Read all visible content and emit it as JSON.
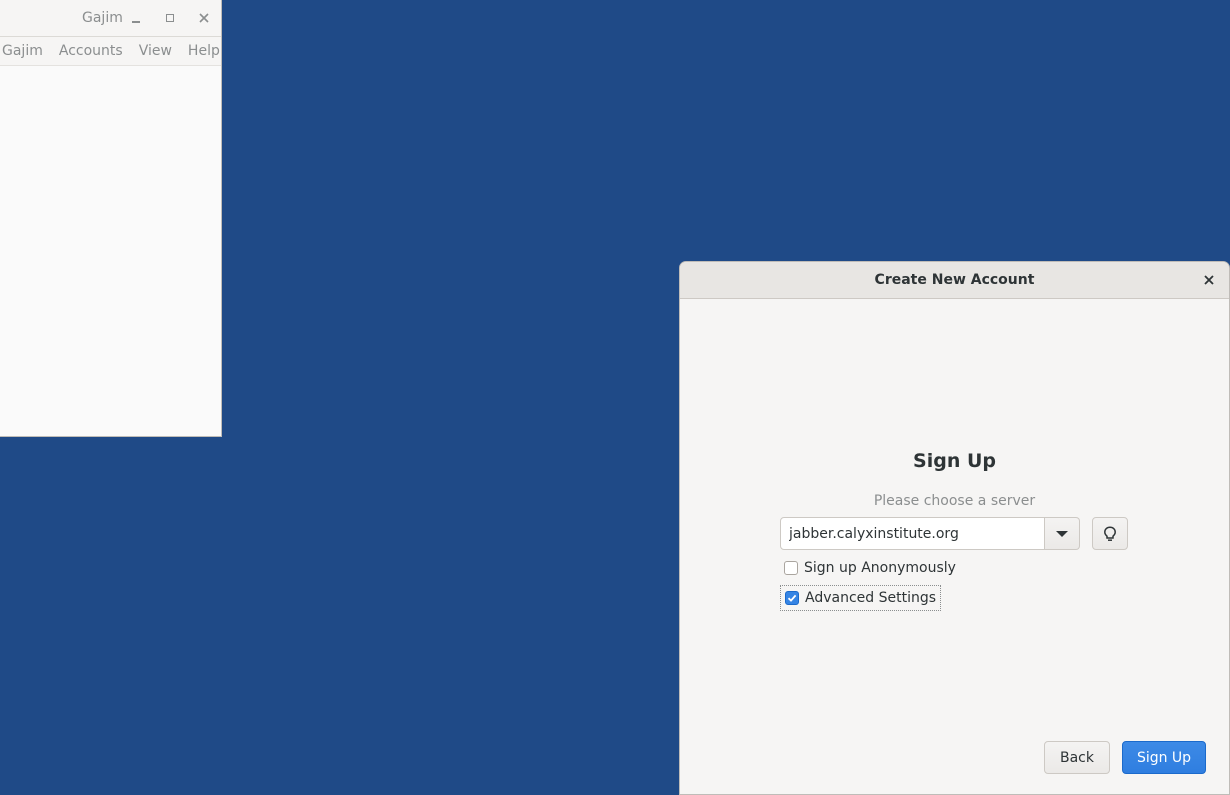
{
  "main_window": {
    "title": "Gajim",
    "menu": [
      "Gajim",
      "Accounts",
      "View",
      "Help"
    ]
  },
  "dialog": {
    "title": "Create New Account",
    "heading": "Sign Up",
    "server_prompt": "Please choose a server",
    "server_value": "jabber.calyxinstitute.org",
    "sign_up_anonymously": {
      "label": "Sign up Anonymously",
      "checked": false
    },
    "advanced_settings": {
      "label": "Advanced Settings",
      "checked": true
    },
    "back_label": "Back",
    "signup_label": "Sign Up"
  },
  "colors": {
    "desktop": "#1f4a87",
    "accent": "#3584e4"
  }
}
